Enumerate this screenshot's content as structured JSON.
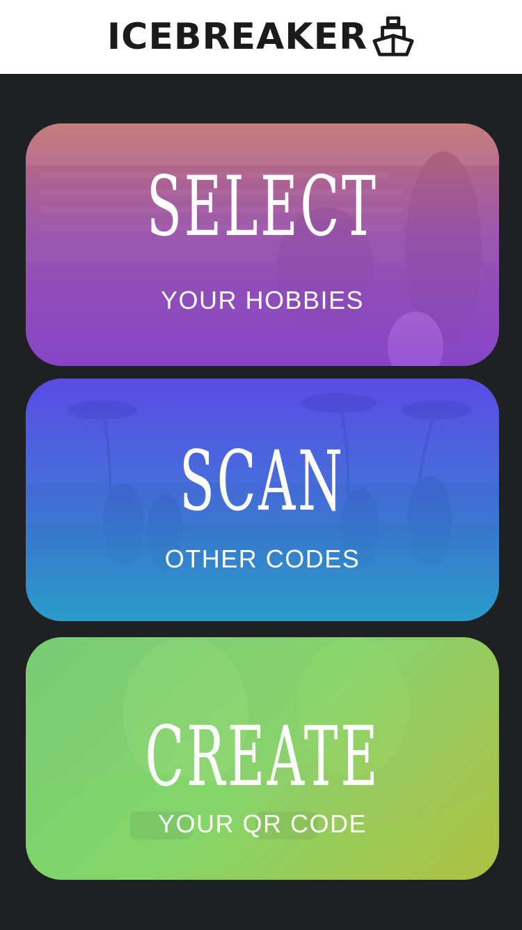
{
  "header": {
    "title": "ICEBREAKER",
    "icon": "ship-icon"
  },
  "cards": [
    {
      "title": "SELECT",
      "subtitle": "YOUR HOBBIES",
      "photo": "football-game-photo"
    },
    {
      "title": "SCAN",
      "subtitle": "OTHER CODES",
      "photo": "beach-friends-photo"
    },
    {
      "title": "CREATE",
      "subtitle": "YOUR QR CODE",
      "photo": "friends-phone-photo"
    }
  ],
  "colors": {
    "header_bg": "#ffffff",
    "page_bg": "#1f2022",
    "select_gradient": [
      "#d67878",
      "#8e46d6"
    ],
    "scan_gradient": [
      "#5a46f0",
      "#28aadc"
    ],
    "create_gradient": [
      "#78d778",
      "#bec83c"
    ]
  }
}
